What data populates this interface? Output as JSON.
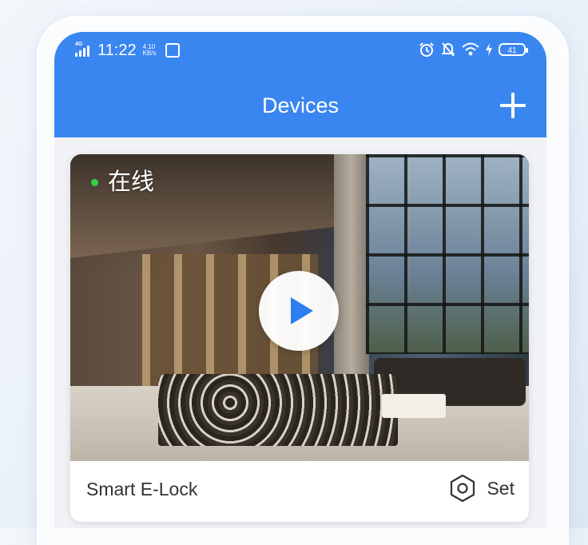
{
  "statusbar": {
    "network": "4G",
    "time": "11:22",
    "speed_value": "4.10",
    "speed_unit": "KB/s",
    "battery": "41"
  },
  "header": {
    "title": "Devices"
  },
  "device_card": {
    "online_status": "在线",
    "name": "Smart E-Lock",
    "settings_label": "Set"
  },
  "colors": {
    "header_blue": "#3a86f0",
    "online_green": "#35d04a",
    "play_blue": "#2d7ff0"
  },
  "icons": [
    "signal-icon",
    "app-notification-icon",
    "alarm-icon",
    "mute-icon",
    "wifi-icon",
    "charging-icon",
    "battery-icon",
    "add-icon",
    "play-icon",
    "settings-hexagon-icon"
  ]
}
